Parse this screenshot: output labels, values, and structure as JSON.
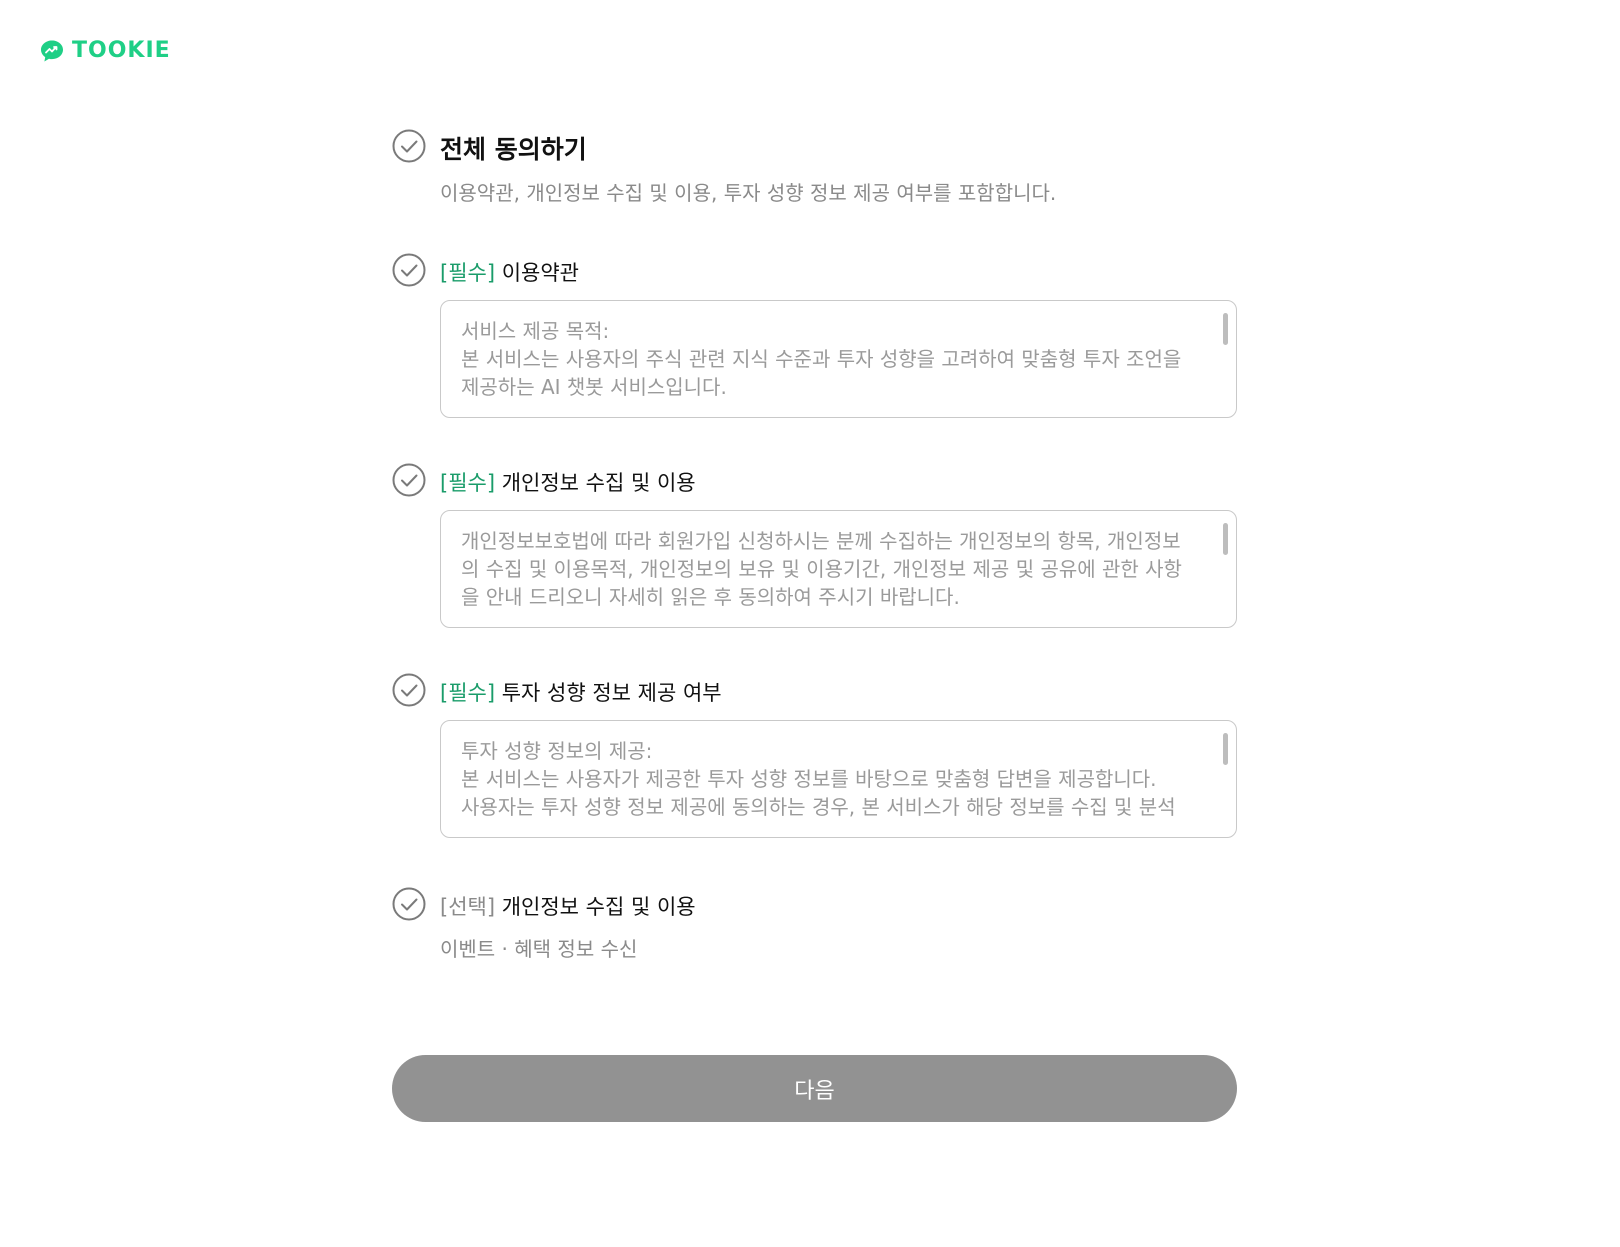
{
  "brand": {
    "name": "TOOKIE",
    "color": "#1fcf86",
    "icon": "chat-bubble-chart-icon"
  },
  "agree_all": {
    "title": "전체 동의하기",
    "description": "이용약관, 개인정보 수집 및 이용, 투자 성향 정보 제공 여부를 포함합니다."
  },
  "terms": [
    {
      "tag": "[필수]",
      "title": "이용약관",
      "content": "서비스 제공 목적:\n본 서비스는 사용자의 주식 관련 지식 수준과 투자 성향을 고려하여 맞춤형 투자 조언을\n제공하는 AI 챗봇 서비스입니다."
    },
    {
      "tag": "[필수]",
      "title": "개인정보 수집 및 이용",
      "content": "개인정보보호법에 따라 회원가입 신청하시는 분께 수집하는 개인정보의 항목, 개인정보\n의 수집 및 이용목적, 개인정보의 보유 및 이용기간, 개인정보 제공 및 공유에 관한 사항\n을 안내 드리오니 자세히 읽은 후 동의하여 주시기 바랍니다."
    },
    {
      "tag": "[필수]",
      "title": "투자 성향 정보 제공 여부",
      "content": "투자 성향 정보의 제공:\n본 서비스는 사용자가 제공한 투자 성향 정보를 바탕으로 맞춤형 답변을 제공합니다.\n사용자는 투자 성향 정보 제공에 동의하는 경우, 본 서비스가 해당 정보를 수집 및 분석"
    }
  ],
  "optional": {
    "tag": "[선택]",
    "title": "개인정보 수집 및 이용",
    "description": "이벤트 · 혜택 정보 수신"
  },
  "next_button": {
    "label": "다음"
  },
  "colors": {
    "required_tag": "#1a9c6a",
    "button_disabled": "#929292"
  }
}
